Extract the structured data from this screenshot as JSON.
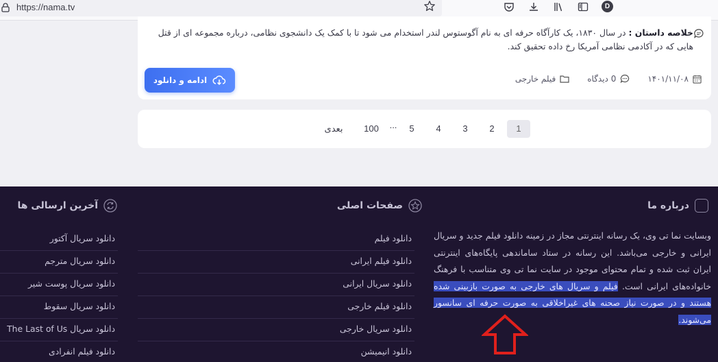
{
  "browser": {
    "url": "https://nama.tv",
    "avatar_letter": "D"
  },
  "post": {
    "summary_label": "خلاصه داستان :",
    "summary_text": " در سال ۱۸۳۰، یک کارآگاه حرفه ای به نام آگوستوس لندر استخدام می شود تا با کمک یک دانشجوی نظامی، درباره مجموعه ای از قتل هایی که در آکادمی نظامی آمریکا رخ داده تحقیق کند.",
    "date": "۱۴۰۱/۱۱/۰۸",
    "views": "0 دیدگاه",
    "category": "فیلم خارجی",
    "button_label": "ادامه و دانلود"
  },
  "pagination": {
    "pages": [
      "1",
      "2",
      "3",
      "4",
      "5",
      "...",
      "100"
    ],
    "next": "بعدی"
  },
  "footer": {
    "about": {
      "title": "درباره ما",
      "text_plain": "وبسایت نما تی وی، یک رسانه اینترنتی مجاز در زمینه دانلود فیلم جدید و سریال ایرانی و خارجی می‌باشد. این رسانه در ستاد ساماندهی پایگاه‌های اینترنتی ایران ثبت شده و تمام محتوای موجود در سایت نما تی وی متناسب با فرهنگ خانواده‌های ایرانی است. ",
      "text_highlighted": "فیلم و سریال های خارجی به صورت بازبینی شده هستند و در صورت نیاز صحنه های غیراخلاقی به صورت حرفه ای سانسور می‌شوند."
    },
    "main_pages": {
      "title": "صفحات اصلی",
      "items": [
        "دانلود فیلم",
        "دانلود فیلم ایرانی",
        "دانلود سریال ایرانی",
        "دانلود فیلم خارجی",
        "دانلود سریال خارجی",
        "دانلود انیمیشن"
      ]
    },
    "latest": {
      "title": "آخرین ارسالی ها",
      "items": [
        "دانلود سریال آکتور",
        "دانلود سریال مترجم",
        "دانلود سریال پوست شیر",
        "دانلود سریال سقوط",
        "دانلود سریال The Last of Us",
        "دانلود فیلم انفرادی"
      ]
    }
  },
  "colors": {
    "accent": "#3d6ff0",
    "footer_bg": "#1e1530",
    "highlight": "#3a4dbd",
    "annotation_arrow": "#e0201c"
  }
}
